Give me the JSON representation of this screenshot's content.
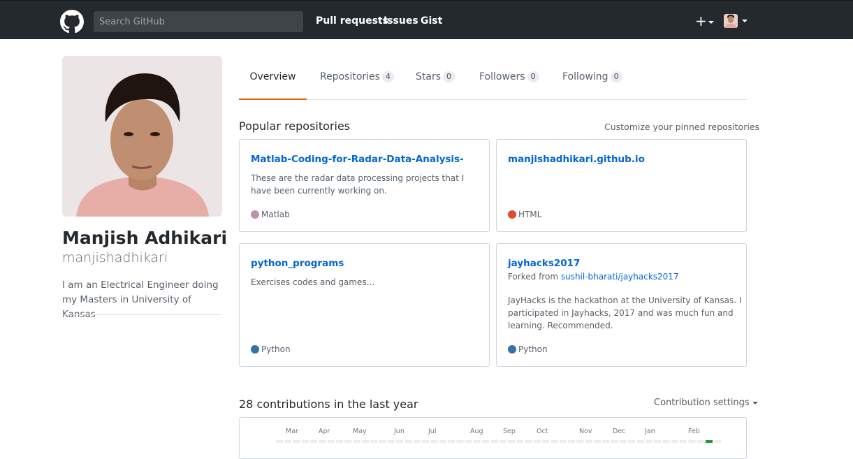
{
  "header": {
    "search_placeholder": "Search GitHub",
    "nav": [
      "Pull requests",
      "Issues",
      "Gist"
    ],
    "plus_label": "+"
  },
  "profile": {
    "fullname": "Manjish Adhikari",
    "username": "manjishadhikari",
    "bio": "I am an Electrical Engineer doing my Masters in University of Kansas"
  },
  "tabs": [
    {
      "label": "Overview",
      "selected": true
    },
    {
      "label": "Repositories",
      "count": "4"
    },
    {
      "label": "Stars",
      "count": "0"
    },
    {
      "label": "Followers",
      "count": "0"
    },
    {
      "label": "Following",
      "count": "0"
    }
  ],
  "popular": {
    "title": "Popular repositories",
    "customize_link": "Customize your pinned repositories",
    "repos": [
      {
        "name": "Matlab-Coding-for-Radar-Data-Analysis-",
        "description": "These are the radar data processing projects that I have been currently working on.",
        "language": "Matlab",
        "color": "#bb92ac"
      },
      {
        "name": "manjishadhikari.github.io",
        "description": "",
        "language": "HTML",
        "color": "#e34c26"
      },
      {
        "name": "python_programs",
        "description": "Exercises codes and games...",
        "language": "Python",
        "color": "#3572A5"
      },
      {
        "name": "jayhacks2017",
        "forked_prefix": "Forked from ",
        "forked_from": "sushil-bharati/jayhacks2017",
        "description": "JayHacks is the hackathon at the University of Kansas. I participated in Jayhacks, 2017 and was much fun and learning. Recommended.",
        "language": "Python",
        "color": "#3572A5"
      }
    ]
  },
  "contributions": {
    "title": "28 contributions in the last year",
    "settings_label": "Contribution settings",
    "months": [
      "Mar",
      "Apr",
      "May",
      "Jun",
      "Jul",
      "Aug",
      "Sep",
      "Oct",
      "Nov",
      "Dec",
      "Jan",
      "Feb"
    ]
  }
}
